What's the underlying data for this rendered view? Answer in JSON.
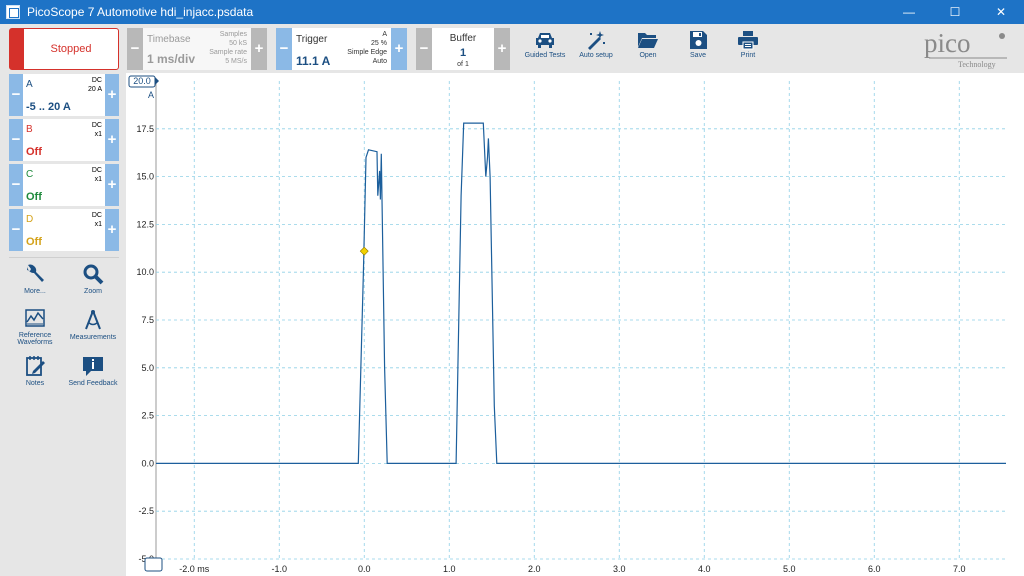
{
  "window": {
    "title": "PicoScope 7 Automotive hdi_injacc.psdata",
    "minimize": "—",
    "maximize": "☐",
    "close": "✕"
  },
  "toolbar": {
    "run_state": "Stopped",
    "timebase": {
      "label": "Timebase",
      "value": "1 ms/div",
      "samples_label": "Samples",
      "samples": "50 kS",
      "rate_label": "Sample rate",
      "rate": "5 MS/s"
    },
    "trigger": {
      "label": "Trigger",
      "value": "11.1 A",
      "channel": "A",
      "pretrigger": "25 %",
      "type": "Simple Edge",
      "mode": "Auto"
    },
    "buffer": {
      "label": "Buffer",
      "value": "1",
      "of": "of 1"
    },
    "buttons": [
      {
        "label": "Guided Tests",
        "icon": "car-icon"
      },
      {
        "label": "Auto setup",
        "icon": "magic-wand-icon"
      },
      {
        "label": "Open",
        "icon": "folder-icon"
      },
      {
        "label": "Save",
        "icon": "floppy-disk-icon"
      },
      {
        "label": "Print",
        "icon": "printer-icon"
      }
    ],
    "logo": {
      "name": "pico",
      "sub": "Technology"
    }
  },
  "channels": [
    {
      "name": "A",
      "coupling": "DC",
      "probe": "20 A",
      "range": "-5 .. 20 A",
      "color": "#1c4f82"
    },
    {
      "name": "B",
      "coupling": "DC",
      "probe": "x1",
      "range": "Off",
      "color": "#d5312b"
    },
    {
      "name": "C",
      "coupling": "DC",
      "probe": "x1",
      "range": "Off",
      "color": "#1e8a3c"
    },
    {
      "name": "D",
      "coupling": "DC",
      "probe": "x1",
      "range": "Off",
      "color": "#d4a21a"
    }
  ],
  "tools": [
    {
      "label": "More...",
      "icon": "wrench-icon"
    },
    {
      "label": "Zoom",
      "icon": "magnifier-icon"
    },
    {
      "label": "Reference Waveforms",
      "icon": "reference-waveform-icon"
    },
    {
      "label": "Measurements",
      "icon": "caliper-icon"
    },
    {
      "label": "Notes",
      "icon": "notepad-icon"
    },
    {
      "label": "Send Feedback",
      "icon": "info-icon"
    }
  ],
  "scope": {
    "axis_badge": "20.0",
    "axis_unit": "A",
    "trigger_marker_value": 11.1,
    "colors": {
      "trace": "#1c5f9c",
      "grid": "#8fd0e6",
      "trigger": "#f0d000"
    }
  },
  "chart_data": {
    "type": "line",
    "xlim": [
      -2.45,
      7.55
    ],
    "ylim": [
      -5,
      20
    ],
    "grid": true,
    "x_ticks": [
      "-2.0 ms",
      "-1.0",
      "0.0",
      "1.0",
      "2.0",
      "3.0",
      "4.0",
      "5.0",
      "6.0",
      "7.0"
    ],
    "x_tick_values": [
      -2,
      -1,
      0,
      1,
      2,
      3,
      4,
      5,
      6,
      7
    ],
    "y_ticks": [
      "17.5",
      "15.0",
      "12.5",
      "10.0",
      "7.5",
      "5.0",
      "2.5",
      "0.0",
      "-2.5",
      "-5.0"
    ],
    "y_tick_values": [
      17.5,
      15,
      12.5,
      10,
      7.5,
      5,
      2.5,
      0,
      -2.5,
      -5
    ],
    "series": [
      {
        "name": "A",
        "x": [
          -2.45,
          -0.07,
          -0.01,
          0.02,
          0.05,
          0.15,
          0.16,
          0.18,
          0.19,
          0.2,
          0.24,
          0.27,
          1.0,
          1.08,
          1.14,
          1.17,
          1.4,
          1.43,
          1.45,
          1.46,
          1.48,
          1.53,
          1.56,
          7.55
        ],
        "y": [
          0.0,
          0.0,
          10.0,
          16.0,
          16.4,
          16.3,
          14.0,
          15.3,
          13.8,
          16.2,
          5.0,
          0.0,
          0.0,
          0.0,
          14.0,
          17.8,
          17.8,
          15.0,
          16.0,
          17.0,
          15.0,
          3.0,
          0.0,
          0.0
        ]
      }
    ]
  }
}
